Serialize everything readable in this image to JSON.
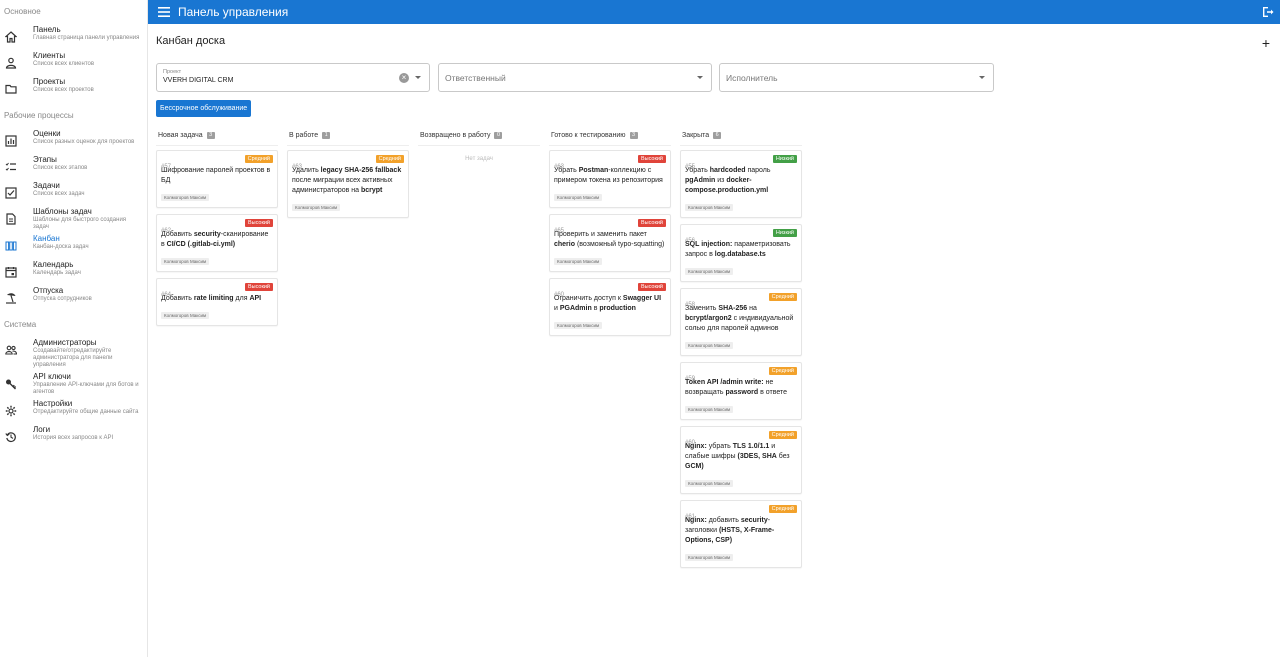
{
  "appbar": {
    "title": "Панель управления"
  },
  "sidebar": {
    "sections": [
      {
        "title": "Основное",
        "items": [
          {
            "label": "Панель",
            "sub": "Главная страница панели управления",
            "icon": "home-icon"
          },
          {
            "label": "Клиенты",
            "sub": "Список всех клиентов",
            "icon": "person-icon"
          },
          {
            "label": "Проекты",
            "sub": "Список всех проектов",
            "icon": "folder-icon"
          }
        ]
      },
      {
        "title": "Рабочие процессы",
        "items": [
          {
            "label": "Оценки",
            "sub": "Список разных оценок для проектов",
            "icon": "chart-icon"
          },
          {
            "label": "Этапы",
            "sub": "Список всех этапов",
            "icon": "checklist-icon"
          },
          {
            "label": "Задачи",
            "sub": "Список всех задач",
            "icon": "checkbox-icon"
          },
          {
            "label": "Шаблоны задач",
            "sub": "Шаблоны для быстрого создания задач",
            "icon": "document-icon"
          },
          {
            "label": "Канбан",
            "sub": "Канбан-доска задач",
            "icon": "kanban-icon",
            "active": true
          },
          {
            "label": "Календарь",
            "sub": "Календарь задач",
            "icon": "calendar-icon"
          },
          {
            "label": "Отпуска",
            "sub": "Отпуска сотрудников",
            "icon": "beach-icon"
          }
        ]
      },
      {
        "title": "Система",
        "items": [
          {
            "label": "Администраторы",
            "sub": "Создавайте/отредактируйте администратора для панели управления",
            "icon": "admins-icon"
          },
          {
            "label": "API ключи",
            "sub": "Управление API-ключами для ботов и агентов",
            "icon": "key-icon"
          },
          {
            "label": "Настройки",
            "sub": "Отредактируйте общие данные сайта",
            "icon": "gear-icon"
          },
          {
            "label": "Логи",
            "sub": "История всех запросов к API",
            "icon": "history-icon"
          }
        ]
      }
    ]
  },
  "main": {
    "title": "Канбан доска",
    "filters": {
      "project_label": "Проект",
      "project_value": "VVERH DIGITAL CRM",
      "responsible_placeholder": "Ответственный",
      "executor_placeholder": "Исполнитель"
    },
    "service_button": "Бессрочное обслуживание",
    "empty_text": "Нет задач"
  },
  "colors": {
    "accent": "#1976d2",
    "high": "#e0443a",
    "medium": "#f2a12a",
    "low": "#43a047"
  },
  "columns": [
    {
      "title": "Новая задача",
      "count": "3",
      "cards": [
        {
          "num": "#57",
          "prio": "Средний",
          "level": "medium",
          "html": "Шифрование паролей проектов в БД",
          "assignee": "Колмогоров Максим"
        },
        {
          "num": "#62",
          "prio": "Высокий",
          "level": "high",
          "html": "Добавить <b>security</b>-сканирование в <b>CI/CD (.gitlab-ci.yml)</b>",
          "assignee": "Колмогоров Максим"
        },
        {
          "num": "#64",
          "prio": "Высокий",
          "level": "high",
          "html": "Добавить <b>rate limiting</b> для <b>API</b>",
          "assignee": "Колмогоров Максим"
        }
      ]
    },
    {
      "title": "В работе",
      "count": "1",
      "cards": [
        {
          "num": "#63",
          "prio": "Средний",
          "level": "medium",
          "html": "Удалить <b>legacy SHA-256 fallback</b> после миграции всех активных администраторов на <b>bcrypt</b>",
          "assignee": "Колмогоров Максим"
        }
      ]
    },
    {
      "title": "Возвращено в работу",
      "count": "0",
      "cards": []
    },
    {
      "title": "Готово к тестированию",
      "count": "3",
      "cards": [
        {
          "num": "#63",
          "prio": "Высокий",
          "level": "high",
          "html": "Убрать <b>Postman</b>-коллекцию с примером токена из репозитория",
          "assignee": "Колмогоров Максим"
        },
        {
          "num": "#65",
          "prio": "Высокий",
          "level": "high",
          "html": "Проверить и заменить пакет <b>cherio</b> (возможный typo-squatting)",
          "assignee": "Колмогоров Максим"
        },
        {
          "num": "#60",
          "prio": "Высокий",
          "level": "high",
          "html": "Ограничить доступ к <b>Swagger UI</b> и <b>PGAdmin</b> в <b>production</b>",
          "assignee": "Колмогоров Максим"
        }
      ]
    },
    {
      "title": "Закрыта",
      "count": "6",
      "cards": [
        {
          "num": "#55",
          "prio": "Низкий",
          "level": "low",
          "html": "Убрать <b>hardcoded</b> пароль <b>pgAdmin</b> из <b>docker-compose.production.yml</b>",
          "assignee": "Колмогоров Максим"
        },
        {
          "num": "#56",
          "prio": "Низкий",
          "level": "low",
          "html": "<b>SQL injection:</b> параметризовать запрос в <b>log.database.ts</b>",
          "assignee": "Колмогоров Максим"
        },
        {
          "num": "#58",
          "prio": "Средний",
          "level": "medium",
          "html": "Заменить <b>SHA-256</b> на <b>bcrypt/argon2</b> с индивидуальной солью для паролей админов",
          "assignee": "Колмогоров Максим"
        },
        {
          "num": "#59",
          "prio": "Средний",
          "level": "medium",
          "html": "<b>Token API /admin write:</b> не возвращать <b>password</b> в ответе",
          "assignee": "Колмогоров Максим"
        },
        {
          "num": "#60",
          "prio": "Средний",
          "level": "medium",
          "html": "<b>Nginx:</b> убрать <b>TLS 1.0/1.1</b> и слабые шифры <b>(3DES, SHA</b> без <b>GCM)</b>",
          "assignee": "Колмогоров Максим"
        },
        {
          "num": "#61",
          "prio": "Средний",
          "level": "medium",
          "html": "<b>Nginx:</b> добавить <b>security</b>-заголовки <b>(HSTS, X-Frame-Options, CSP)</b>",
          "assignee": "Колмогоров Максим"
        }
      ]
    }
  ]
}
